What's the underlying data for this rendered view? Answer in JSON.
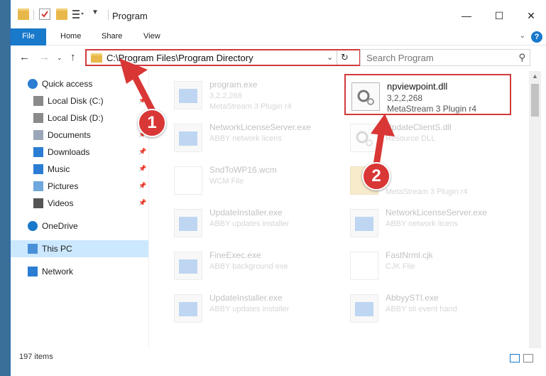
{
  "window": {
    "title": "Program",
    "controls": {
      "minimize": "—",
      "maximize": "☐",
      "close": "✕"
    }
  },
  "ribbon": {
    "tabs": [
      "File",
      "Home",
      "Share",
      "View"
    ],
    "help": "?"
  },
  "nav": {
    "address": "C:\\Program Files\\Program Directory",
    "search_placeholder": "Search Program"
  },
  "sidebar": {
    "items": [
      {
        "label": "Quick access",
        "icon": "star-icon",
        "pinned": false
      },
      {
        "label": "Local Disk (C:)",
        "icon": "drive-icon",
        "pinned": true
      },
      {
        "label": "Local Disk (D:)",
        "icon": "drive-icon",
        "pinned": true
      },
      {
        "label": "Documents",
        "icon": "documents-icon",
        "pinned": true
      },
      {
        "label": "Downloads",
        "icon": "download-icon",
        "pinned": true
      },
      {
        "label": "Music",
        "icon": "music-icon",
        "pinned": true
      },
      {
        "label": "Pictures",
        "icon": "pictures-icon",
        "pinned": true
      },
      {
        "label": "Videos",
        "icon": "videos-icon",
        "pinned": true
      },
      {
        "label": "OneDrive",
        "icon": "cloud-icon",
        "pinned": false
      },
      {
        "label": "This PC",
        "icon": "computer-icon",
        "pinned": false
      },
      {
        "label": "Network",
        "icon": "network-icon",
        "pinned": false
      }
    ]
  },
  "files": [
    {
      "name": "program.exe",
      "meta1": "3,2,2,268",
      "meta2": "MetaStream 3 Plugin r4",
      "icon": "exe"
    },
    {
      "name": "npviewpoint.dll",
      "meta1": "3,2,2,268",
      "meta2": "MetaStream 3 Plugin r4",
      "icon": "dll"
    },
    {
      "name": "NetworkLicenseServer.exe",
      "meta1": "ABBY network licens",
      "meta2": "",
      "icon": "exe"
    },
    {
      "name": "UpdateClientS.dll",
      "meta1": "Resource DLL",
      "meta2": "",
      "icon": "dll"
    },
    {
      "name": "SndToWP16.wcm",
      "meta1": "WCM File",
      "meta2": "",
      "icon": "doc"
    },
    {
      "name": "",
      "meta1": "",
      "meta2": "MetaStream 3 Plugin r4",
      "icon": "folder"
    },
    {
      "name": "UpdateInstaller.exe",
      "meta1": "ABBY updates installer",
      "meta2": "",
      "icon": "exe"
    },
    {
      "name": "NetworkLicenseServer.exe",
      "meta1": "ABBY network licens",
      "meta2": "",
      "icon": "exe"
    },
    {
      "name": "FineExec.exe",
      "meta1": "ABBY background exe",
      "meta2": "",
      "icon": "exe"
    },
    {
      "name": "FastNrml.cjk",
      "meta1": "CJK File",
      "meta2": "",
      "icon": "doc"
    },
    {
      "name": "UpdateInstaller.exe",
      "meta1": "ABBY updates installer",
      "meta2": "",
      "icon": "exe"
    },
    {
      "name": "AbbyySTI.exe",
      "meta1": "ABBY sti event hand",
      "meta2": "",
      "icon": "exe"
    }
  ],
  "status": {
    "count": "197 items"
  },
  "annotations": {
    "step1": "1",
    "step2": "2",
    "color": "#d93636"
  }
}
